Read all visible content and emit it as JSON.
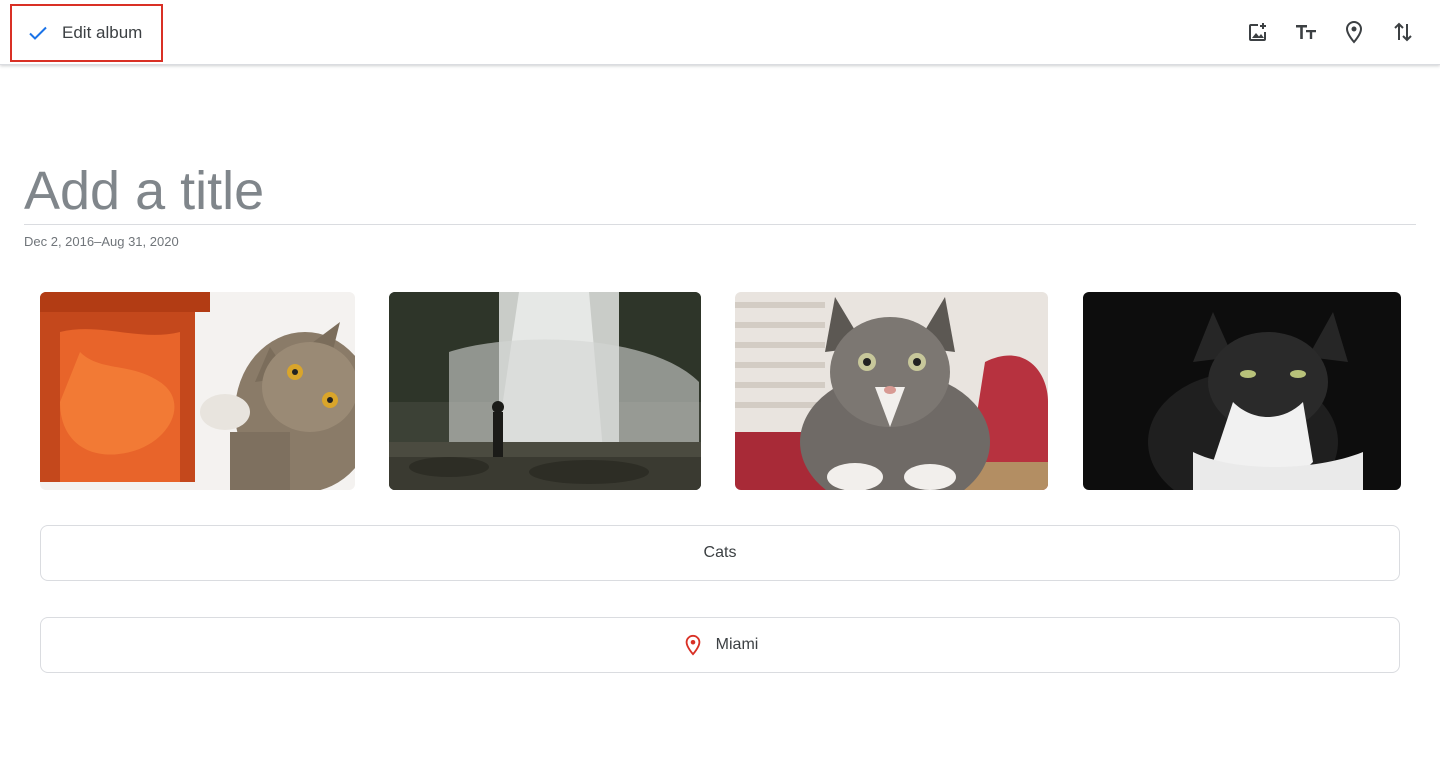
{
  "toolbar": {
    "done_label": "Edit album",
    "tools": [
      {
        "icon": "add-photo-icon"
      },
      {
        "icon": "text-icon"
      },
      {
        "icon": "location-icon"
      },
      {
        "icon": "sort-icon"
      }
    ]
  },
  "album": {
    "title_placeholder": "Add a title",
    "title_value": "",
    "date_range": "Dec 2, 2016–Aug 31, 2020"
  },
  "text_block": {
    "text": "Cats"
  },
  "location_block": {
    "text": "Miami",
    "pin_color": "#d93025"
  },
  "colors": {
    "accent": "#1a73e8",
    "highlight_border": "#d93025"
  }
}
